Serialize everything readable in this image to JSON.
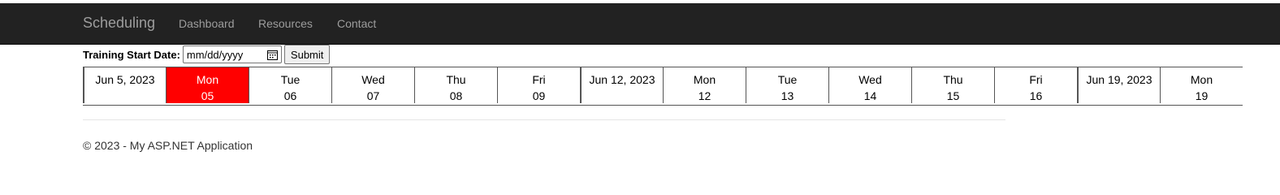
{
  "navbar": {
    "brand": "Scheduling",
    "links": [
      "Dashboard",
      "Resources",
      "Contact"
    ]
  },
  "form": {
    "label": "Training Start Date:",
    "date_placeholder": "mm/dd/yyyy",
    "submit_label": "Submit"
  },
  "schedule": {
    "selected_color": "#ff0000",
    "cells": [
      {
        "type": "week",
        "label": "Jun 5, 2023"
      },
      {
        "type": "day",
        "day": "Mon",
        "date": "05",
        "selected": true
      },
      {
        "type": "day",
        "day": "Tue",
        "date": "06"
      },
      {
        "type": "day",
        "day": "Wed",
        "date": "07"
      },
      {
        "type": "day",
        "day": "Thu",
        "date": "08"
      },
      {
        "type": "day",
        "day": "Fri",
        "date": "09"
      },
      {
        "type": "week",
        "label": "Jun 12, 2023"
      },
      {
        "type": "day",
        "day": "Mon",
        "date": "12"
      },
      {
        "type": "day",
        "day": "Tue",
        "date": "13"
      },
      {
        "type": "day",
        "day": "Wed",
        "date": "14"
      },
      {
        "type": "day",
        "day": "Thu",
        "date": "15"
      },
      {
        "type": "day",
        "day": "Fri",
        "date": "16"
      },
      {
        "type": "week",
        "label": "Jun 19, 2023"
      },
      {
        "type": "day",
        "day": "Mon",
        "date": "19"
      }
    ]
  },
  "footer": {
    "text": "© 2023 - My ASP.NET Application"
  }
}
